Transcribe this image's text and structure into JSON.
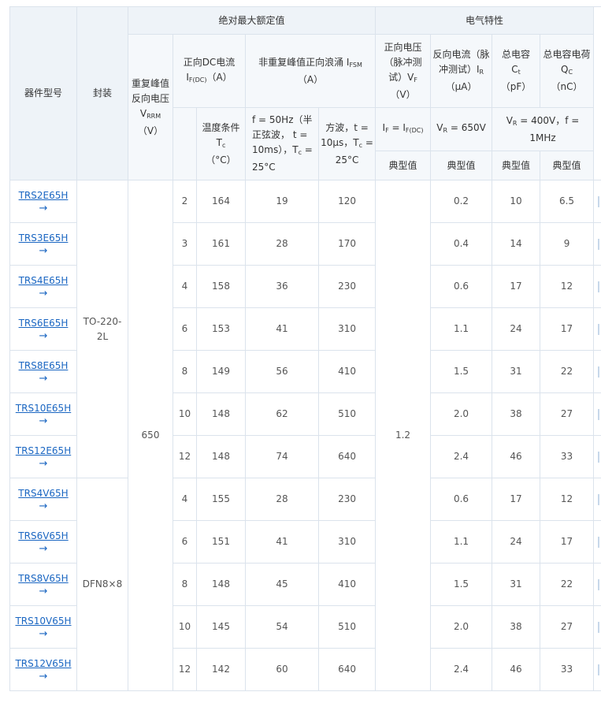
{
  "header": {
    "abs_max": "绝对最大额定值",
    "elec": "电气特性",
    "col_model": "器件型号",
    "col_package": "封装",
    "col_vrrm": {
      "text": "重复峰值反向电压",
      "sym": "V",
      "sub": "RRM",
      "unit": "（V）"
    },
    "col_ifdc": {
      "text": "正向DC电流",
      "sym": "I",
      "sub": "F(DC)",
      "unit": "（A）"
    },
    "col_ifsm": {
      "text": "非重复峰值正向浪涌 ",
      "sym": "I",
      "sub": "FSM",
      "unit": "（A）"
    },
    "col_vf": {
      "text": "正向电压（脉冲测试）",
      "sym": "V",
      "sub": "F",
      "unit": "（V）"
    },
    "col_ir": {
      "text": "反向电流（脉冲测试）",
      "sym": "I",
      "sub": "R",
      "unit": "（μA）"
    },
    "col_ct": {
      "text": "总电容",
      "sym": "C",
      "sub": "t",
      "unit": "（pF）"
    },
    "col_qc": {
      "text": "总电容电荷",
      "sym": "Q",
      "sub": "C",
      "unit": "（nC）"
    },
    "temp": {
      "text": "温度条件",
      "sym": "T",
      "sub": "c",
      "unit": "（°C）"
    },
    "surge_50hz": {
      "pre": "f = 50Hz（半正弦波， t = 10ms），",
      "sym": "T",
      "sub": "c",
      "post": " = 25°C"
    },
    "surge_square": {
      "pre": "方波，t = 10μs，",
      "sym": "T",
      "sub": "c",
      "post": " = 25°C"
    },
    "cond_vf": {
      "a": "I",
      "a_sub": "F",
      "mid": " = ",
      "b": "I",
      "b_sub": "F(DC)"
    },
    "cond_ir": {
      "a": "V",
      "a_sub": "R",
      "post": " = 650V"
    },
    "cond_ct": {
      "a": "V",
      "a_sub": "R",
      "post": " = 400V，f = 1MHz"
    },
    "typ": "典型值"
  },
  "shared": {
    "vrrm": "650",
    "vf": "1.2",
    "package_a": "TO-220-2L",
    "package_b": "DFN8×8"
  },
  "arrow": "→",
  "rows": [
    {
      "model": "TRS2E65H",
      "ifdc": "2",
      "temp": "164",
      "ifsm_sine": "19",
      "ifsm_square": "120",
      "ir": "0.2",
      "ct": "10",
      "qc": "6.5"
    },
    {
      "model": "TRS3E65H",
      "ifdc": "3",
      "temp": "161",
      "ifsm_sine": "28",
      "ifsm_square": "170",
      "ir": "0.4",
      "ct": "14",
      "qc": "9"
    },
    {
      "model": "TRS4E65H",
      "ifdc": "4",
      "temp": "158",
      "ifsm_sine": "36",
      "ifsm_square": "230",
      "ir": "0.6",
      "ct": "17",
      "qc": "12"
    },
    {
      "model": "TRS6E65H",
      "ifdc": "6",
      "temp": "153",
      "ifsm_sine": "41",
      "ifsm_square": "310",
      "ir": "1.1",
      "ct": "24",
      "qc": "17"
    },
    {
      "model": "TRS8E65H",
      "ifdc": "8",
      "temp": "149",
      "ifsm_sine": "56",
      "ifsm_square": "410",
      "ir": "1.5",
      "ct": "31",
      "qc": "22"
    },
    {
      "model": "TRS10E65H",
      "ifdc": "10",
      "temp": "148",
      "ifsm_sine": "62",
      "ifsm_square": "510",
      "ir": "2.0",
      "ct": "38",
      "qc": "27"
    },
    {
      "model": "TRS12E65H",
      "ifdc": "12",
      "temp": "148",
      "ifsm_sine": "74",
      "ifsm_square": "640",
      "ir": "2.4",
      "ct": "46",
      "qc": "33"
    },
    {
      "model": "TRS4V65H",
      "ifdc": "4",
      "temp": "155",
      "ifsm_sine": "28",
      "ifsm_square": "230",
      "ir": "0.6",
      "ct": "17",
      "qc": "12"
    },
    {
      "model": "TRS6V65H",
      "ifdc": "6",
      "temp": "151",
      "ifsm_sine": "41",
      "ifsm_square": "310",
      "ir": "1.1",
      "ct": "24",
      "qc": "17"
    },
    {
      "model": "TRS8V65H",
      "ifdc": "8",
      "temp": "148",
      "ifsm_sine": "45",
      "ifsm_square": "410",
      "ir": "1.5",
      "ct": "31",
      "qc": "22"
    },
    {
      "model": "TRS10V65H",
      "ifdc": "10",
      "temp": "145",
      "ifsm_sine": "54",
      "ifsm_square": "510",
      "ir": "2.0",
      "ct": "38",
      "qc": "27"
    },
    {
      "model": "TRS12V65H",
      "ifdc": "12",
      "temp": "142",
      "ifsm_sine": "60",
      "ifsm_square": "640",
      "ir": "2.4",
      "ct": "46",
      "qc": "33"
    }
  ]
}
